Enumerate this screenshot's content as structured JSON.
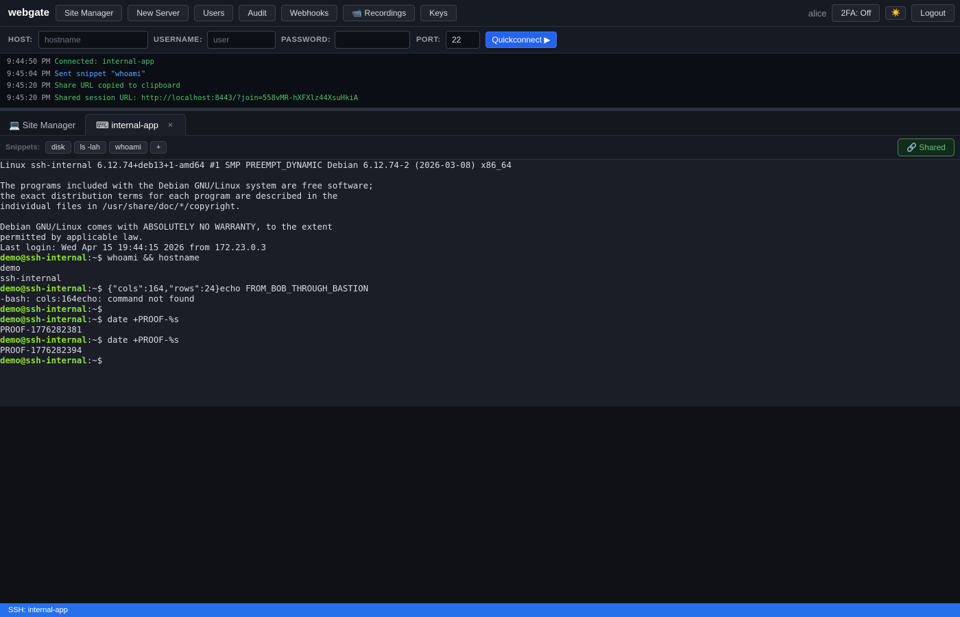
{
  "app": {
    "brand": "webgate"
  },
  "nav": {
    "buttons": [
      "Site Manager",
      "New Server",
      "Users",
      "Audit",
      "Webhooks",
      "📹 Recordings",
      "Keys"
    ],
    "user": "alice",
    "twofa_label": "2FA: Off",
    "theme_icon": "☀️",
    "logout_label": "Logout"
  },
  "quickconnect": {
    "host_label": "HOST:",
    "host_placeholder": "hostname",
    "host_value": "",
    "username_label": "USERNAME:",
    "username_placeholder": "user",
    "username_value": "",
    "password_label": "PASSWORD:",
    "password_value": "",
    "port_label": "PORT:",
    "port_value": "22",
    "button_label": "Quickconnect ▶"
  },
  "log": [
    {
      "time": "9:44:50 PM",
      "msg": "Connected: internal-app",
      "color": "green"
    },
    {
      "time": "9:45:04 PM",
      "msg": "Sent snippet \"whoami\"",
      "color": "blue"
    },
    {
      "time": "9:45:20 PM",
      "msg": "Share URL copied to clipboard",
      "color": "green"
    },
    {
      "time": "9:45:20 PM",
      "msg": "Shared session URL: http://localhost:8443/?join=558vMR-hXFXlz44XsuHkiA",
      "color": "green"
    }
  ],
  "tabs": {
    "site_manager": "💻 Site Manager",
    "active": "⌨ internal-app",
    "close_glyph": "×"
  },
  "snippets": {
    "label": "Snippets:",
    "items": [
      "disk",
      "ls -lah",
      "whoami",
      "+"
    ],
    "shared_label": "🔗 Shared"
  },
  "terminal": {
    "prompt": "demo@ssh-internal",
    "prompt_suffix": ":~$",
    "lines": [
      {
        "type": "out",
        "text": "Linux ssh-internal 6.12.74+deb13+1-amd64 #1 SMP PREEMPT_DYNAMIC Debian 6.12.74-2 (2026-03-08) x86_64"
      },
      {
        "type": "out",
        "text": ""
      },
      {
        "type": "out",
        "text": "The programs included with the Debian GNU/Linux system are free software;"
      },
      {
        "type": "out",
        "text": "the exact distribution terms for each program are described in the"
      },
      {
        "type": "out",
        "text": "individual files in /usr/share/doc/*/copyright."
      },
      {
        "type": "out",
        "text": ""
      },
      {
        "type": "out",
        "text": "Debian GNU/Linux comes with ABSOLUTELY NO WARRANTY, to the extent"
      },
      {
        "type": "out",
        "text": "permitted by applicable law."
      },
      {
        "type": "out",
        "text": "Last login: Wed Apr 15 19:44:15 2026 from 172.23.0.3"
      },
      {
        "type": "cmd",
        "text": " whoami && hostname"
      },
      {
        "type": "out",
        "text": "demo"
      },
      {
        "type": "out",
        "text": "ssh-internal"
      },
      {
        "type": "cmd",
        "text": " {\"cols\":164,\"rows\":24}echo FROM_BOB_THROUGH_BASTION"
      },
      {
        "type": "out",
        "text": "-bash: cols:164echo: command not found"
      },
      {
        "type": "cmd",
        "text": ""
      },
      {
        "type": "cmd",
        "text": " date +PROOF-%s"
      },
      {
        "type": "out",
        "text": "PROOF-1776282381"
      },
      {
        "type": "cmd",
        "text": " date +PROOF-%s"
      },
      {
        "type": "out",
        "text": "PROOF-1776282394"
      },
      {
        "type": "cmd",
        "text": ""
      }
    ]
  },
  "status": {
    "text": "SSH: internal-app"
  },
  "colors": {
    "accent": "#2463eb",
    "prompt": "#8ae234",
    "log_green": "#4ac26b",
    "log_blue": "#58a6ff"
  }
}
